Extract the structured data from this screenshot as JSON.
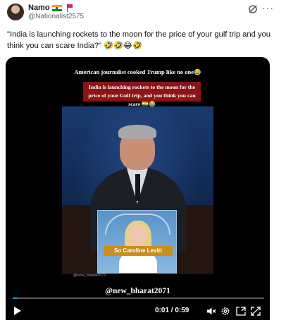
{
  "post": {
    "author_name": "Namo",
    "author_handle": "@Nationalist2575",
    "text": "\"India is launching rockets to the moon for the price of your gulf trip and you think you can scare India?\" 🤣🤣😂🤣"
  },
  "video": {
    "caption_top": "American journalist cooked Trump like no one😂",
    "caption_banner": "India is launching rockets to the moon for the price of your Gulf trip, and you think you can scare 🇮🇳😂",
    "inset_caption": "So Caroline Levitt",
    "watermark_small": "@new_bharat2071",
    "watermark_big": "@new_bharat2071",
    "time": "0:01 / 0:59",
    "progress": 0.017
  },
  "icons": {
    "grok": "grok-icon",
    "more": "more-icon",
    "play": "play-icon",
    "mute": "mute-icon",
    "settings": "settings-icon",
    "pip": "picture-in-picture-icon",
    "fullscreen": "fullscreen-icon"
  },
  "colors": {
    "accent": "#1d9bf0",
    "text": "#0f1419",
    "secondary": "#536471",
    "banner": "#8b1414",
    "inset_caption_bg": "#c98e1d"
  }
}
